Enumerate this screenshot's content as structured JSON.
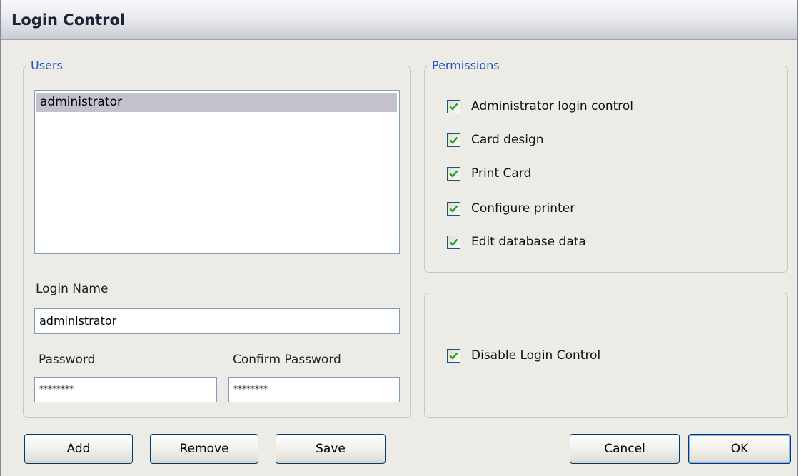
{
  "window": {
    "title": "Login Control"
  },
  "users": {
    "legend": "Users",
    "list": [
      "administrator"
    ],
    "login_name_label": "Login Name",
    "login_name_value": "administrator",
    "password_label": "Password",
    "password_value": "********",
    "confirm_label": "Confirm Password",
    "confirm_value": "********"
  },
  "permissions": {
    "legend": "Permissions",
    "items": [
      {
        "label": "Administrator login control",
        "checked": true
      },
      {
        "label": "Card design",
        "checked": true
      },
      {
        "label": "Print Card",
        "checked": true
      },
      {
        "label": "Configure printer",
        "checked": true
      },
      {
        "label": "Edit database data",
        "checked": true
      }
    ]
  },
  "options": {
    "disable_login_control": {
      "label": "Disable Login Control",
      "checked": true
    }
  },
  "buttons": {
    "add": "Add",
    "remove": "Remove",
    "save": "Save",
    "cancel": "Cancel",
    "ok": "OK"
  },
  "colors": {
    "legend": "#1f53c9",
    "check": "#21a121",
    "selection": "#c3c2cc"
  }
}
